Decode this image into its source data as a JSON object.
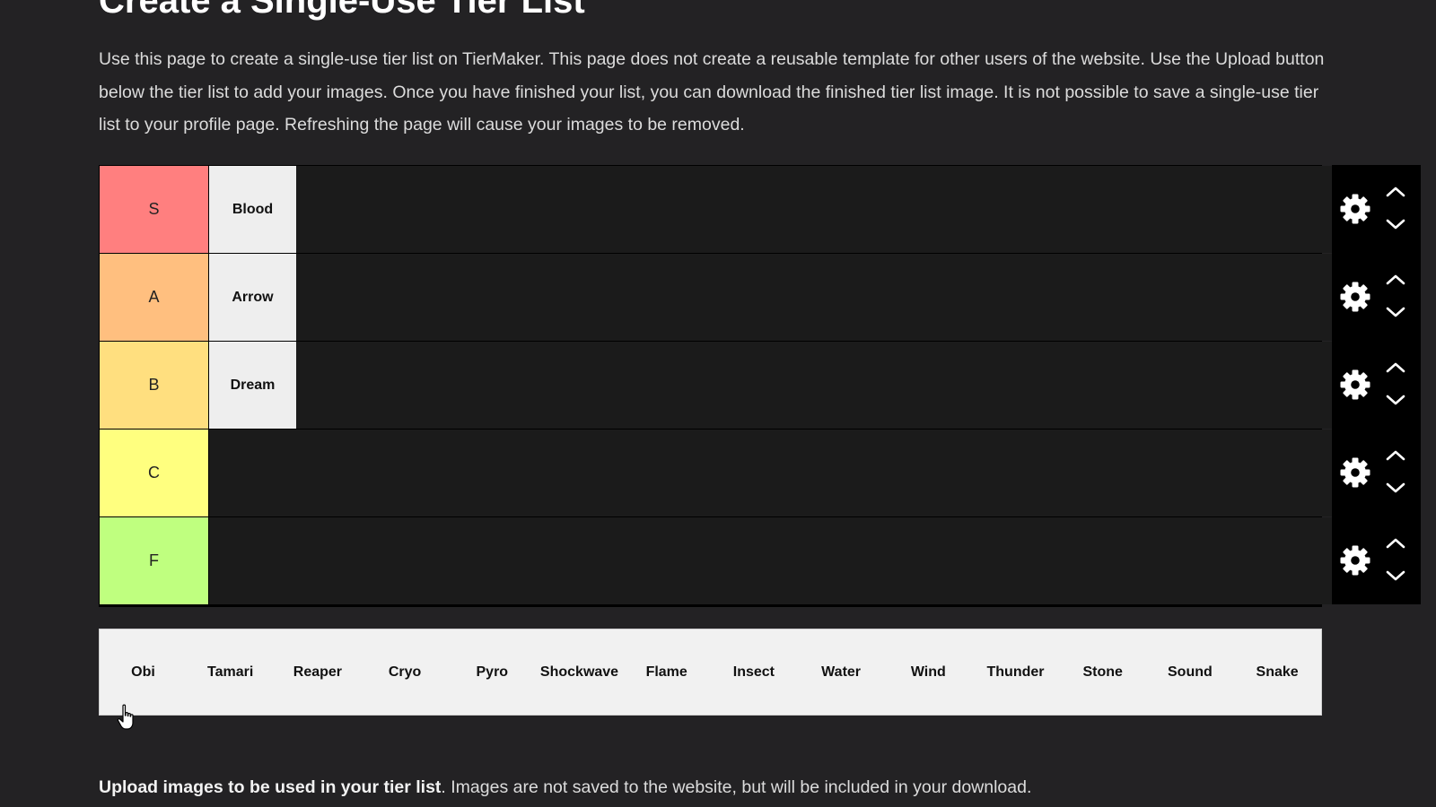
{
  "page": {
    "title": "Create a Single-Use Tier List",
    "intro": "Use this page to create a single-use tier list on TierMaker. This page does not create a reusable template for other users of the website. Use the Upload button below the tier list to add your images. Once you have finished your list, you can download the finished tier list image. It is not possible to save a single-use tier list to your profile page. Refreshing the page will cause your images to be removed."
  },
  "tiers": [
    {
      "label": "S",
      "color": "#ff7f7f",
      "items": [
        "Blood"
      ]
    },
    {
      "label": "A",
      "color": "#ffbf7f",
      "items": [
        "Arrow"
      ]
    },
    {
      "label": "B",
      "color": "#ffdf7f",
      "items": [
        "Dream"
      ]
    },
    {
      "label": "C",
      "color": "#ffff7f",
      "items": []
    },
    {
      "label": "F",
      "color": "#bfff7f",
      "items": []
    }
  ],
  "icons": {
    "settings": "gear-icon",
    "move_up": "chevron-up-icon",
    "move_down": "chevron-down-icon",
    "cursor": "hand-pointer-icon"
  },
  "bank": {
    "items": [
      "Obi",
      "Tamari",
      "Reaper",
      "Cryo",
      "Pyro",
      "Shockwave",
      "Flame",
      "Insect",
      "Water",
      "Wind",
      "Thunder",
      "Stone",
      "Sound",
      "Snake"
    ]
  },
  "upload": {
    "bold": "Upload images to be used in your tier list",
    "rest": ". Images are not saved to the website, but will be included in your download."
  }
}
